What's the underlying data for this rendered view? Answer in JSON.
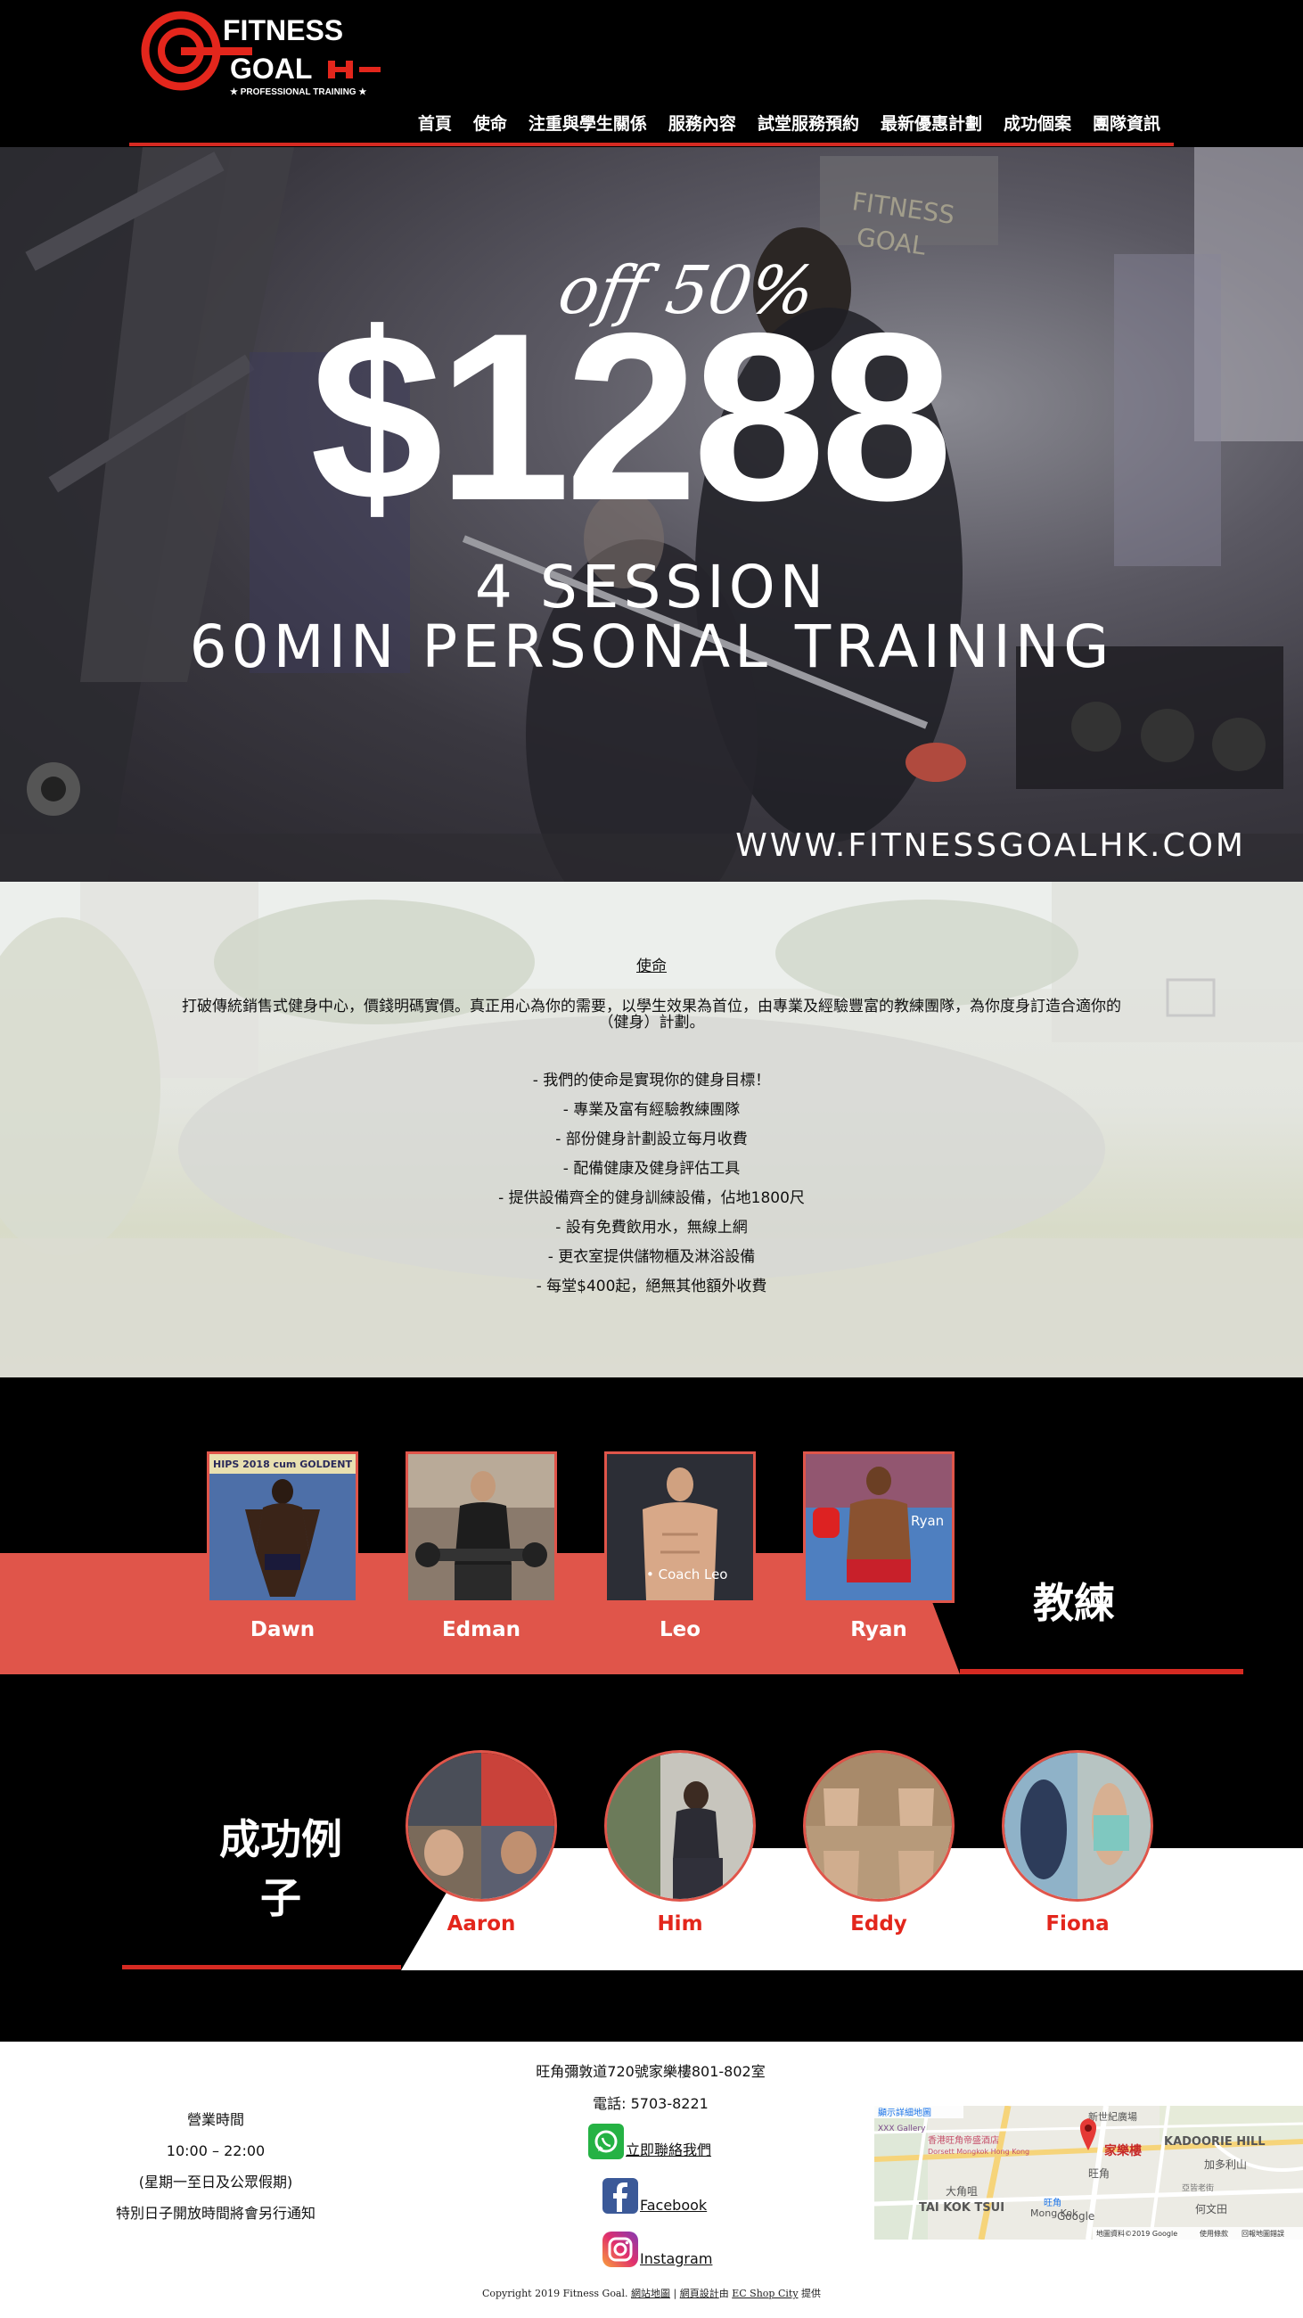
{
  "header": {
    "logo_line1": "FITNESS",
    "logo_line2": "GOAL",
    "logo_tagline": "★ PROFESSIONAL TRAINING ★",
    "nav": [
      "首頁",
      "使命",
      "注重與學生關係",
      "服務內容",
      "試堂服務預約",
      "最新優惠計劃",
      "成功個案",
      "團隊資訊"
    ]
  },
  "hero": {
    "discount": "off 50%",
    "price": "$1288",
    "sessions": "4 SESSION",
    "training": "60MIN PERSONAL TRAINING",
    "url": "WWW.FITNESSGOALHK.COM"
  },
  "mission": {
    "title": "使命",
    "description": "打破傳統銷售式健身中心，價錢明碼實價。真正用心為你的需要，以學生效果為首位，由專業及經驗豐富的教練團隊，為你度身訂造合適你的（健身）計劃。",
    "points": [
      "- 我們的使命是實現你的健身目標！",
      "- 專業及富有經驗教練團隊",
      "- 部份健身計劃設立每月收費",
      "- 配備健康及健身評估工具",
      "- 提供設備齊全的健身訓練設備，佔地1800尺",
      "- 設有免費飲用水，無線上網",
      "- 更衣室提供儲物櫃及淋浴設備",
      "- 每堂$400起，絕無其他額外收費"
    ]
  },
  "coaches": {
    "title": "教練",
    "items": [
      {
        "name": "Dawn",
        "photo_text": "HIPS 2018 cum GOLDENT"
      },
      {
        "name": "Edman",
        "photo_text": ""
      },
      {
        "name": "Leo",
        "photo_text": "• Coach Leo"
      },
      {
        "name": "Ryan",
        "photo_text": "Ryan"
      }
    ]
  },
  "success": {
    "title_line1": "成功例",
    "title_line2": "子",
    "items": [
      "Aaron",
      "Him",
      "Eddy",
      "Fiona"
    ]
  },
  "footer": {
    "hours_title": "營業時間",
    "hours_time": "10:00 – 22:00",
    "hours_days": "(星期一至日及公眾假期)",
    "hours_note": "特別日子開放時間將會另行通知",
    "address": "旺角彌敦道720號家樂樓801-802室",
    "phone": "電話:  5703-8221",
    "whatsapp_label": "立即聯絡我們",
    "facebook_label": "Facebook",
    "instagram_label": "Instagram",
    "map": {
      "detail_link": "顯示詳細地圖",
      "pin_label": "家樂樓",
      "hotel": "香港旺角帝盛酒店",
      "hotel_en": "Dorsett Mongkok Hong Kong",
      "gallery": "XXX Gallery",
      "labels": [
        "新世紀廣場",
        "KADOORIE HILL",
        "加多利山",
        "旺角",
        "亞皆老街",
        "大角咀",
        "TAI KOK TSUI",
        "Mong Kok",
        "何文田",
        "旺角"
      ],
      "attribution": "地圖資料©2019 Google",
      "terms": "使用條款",
      "report": "回報地圖錯誤",
      "google": "Google"
    },
    "copyright_prefix": "Copyright 2019 Fitness Goal.",
    "sitemap": "網站地圖",
    "sep": "|",
    "design": "網頁設計",
    "by": "由",
    "ec": "EC Shop City",
    "provided": "提供"
  },
  "colors": {
    "accent_red": "#d62a22",
    "coach_band": "#e0554a",
    "case_name": "#e3261c"
  }
}
